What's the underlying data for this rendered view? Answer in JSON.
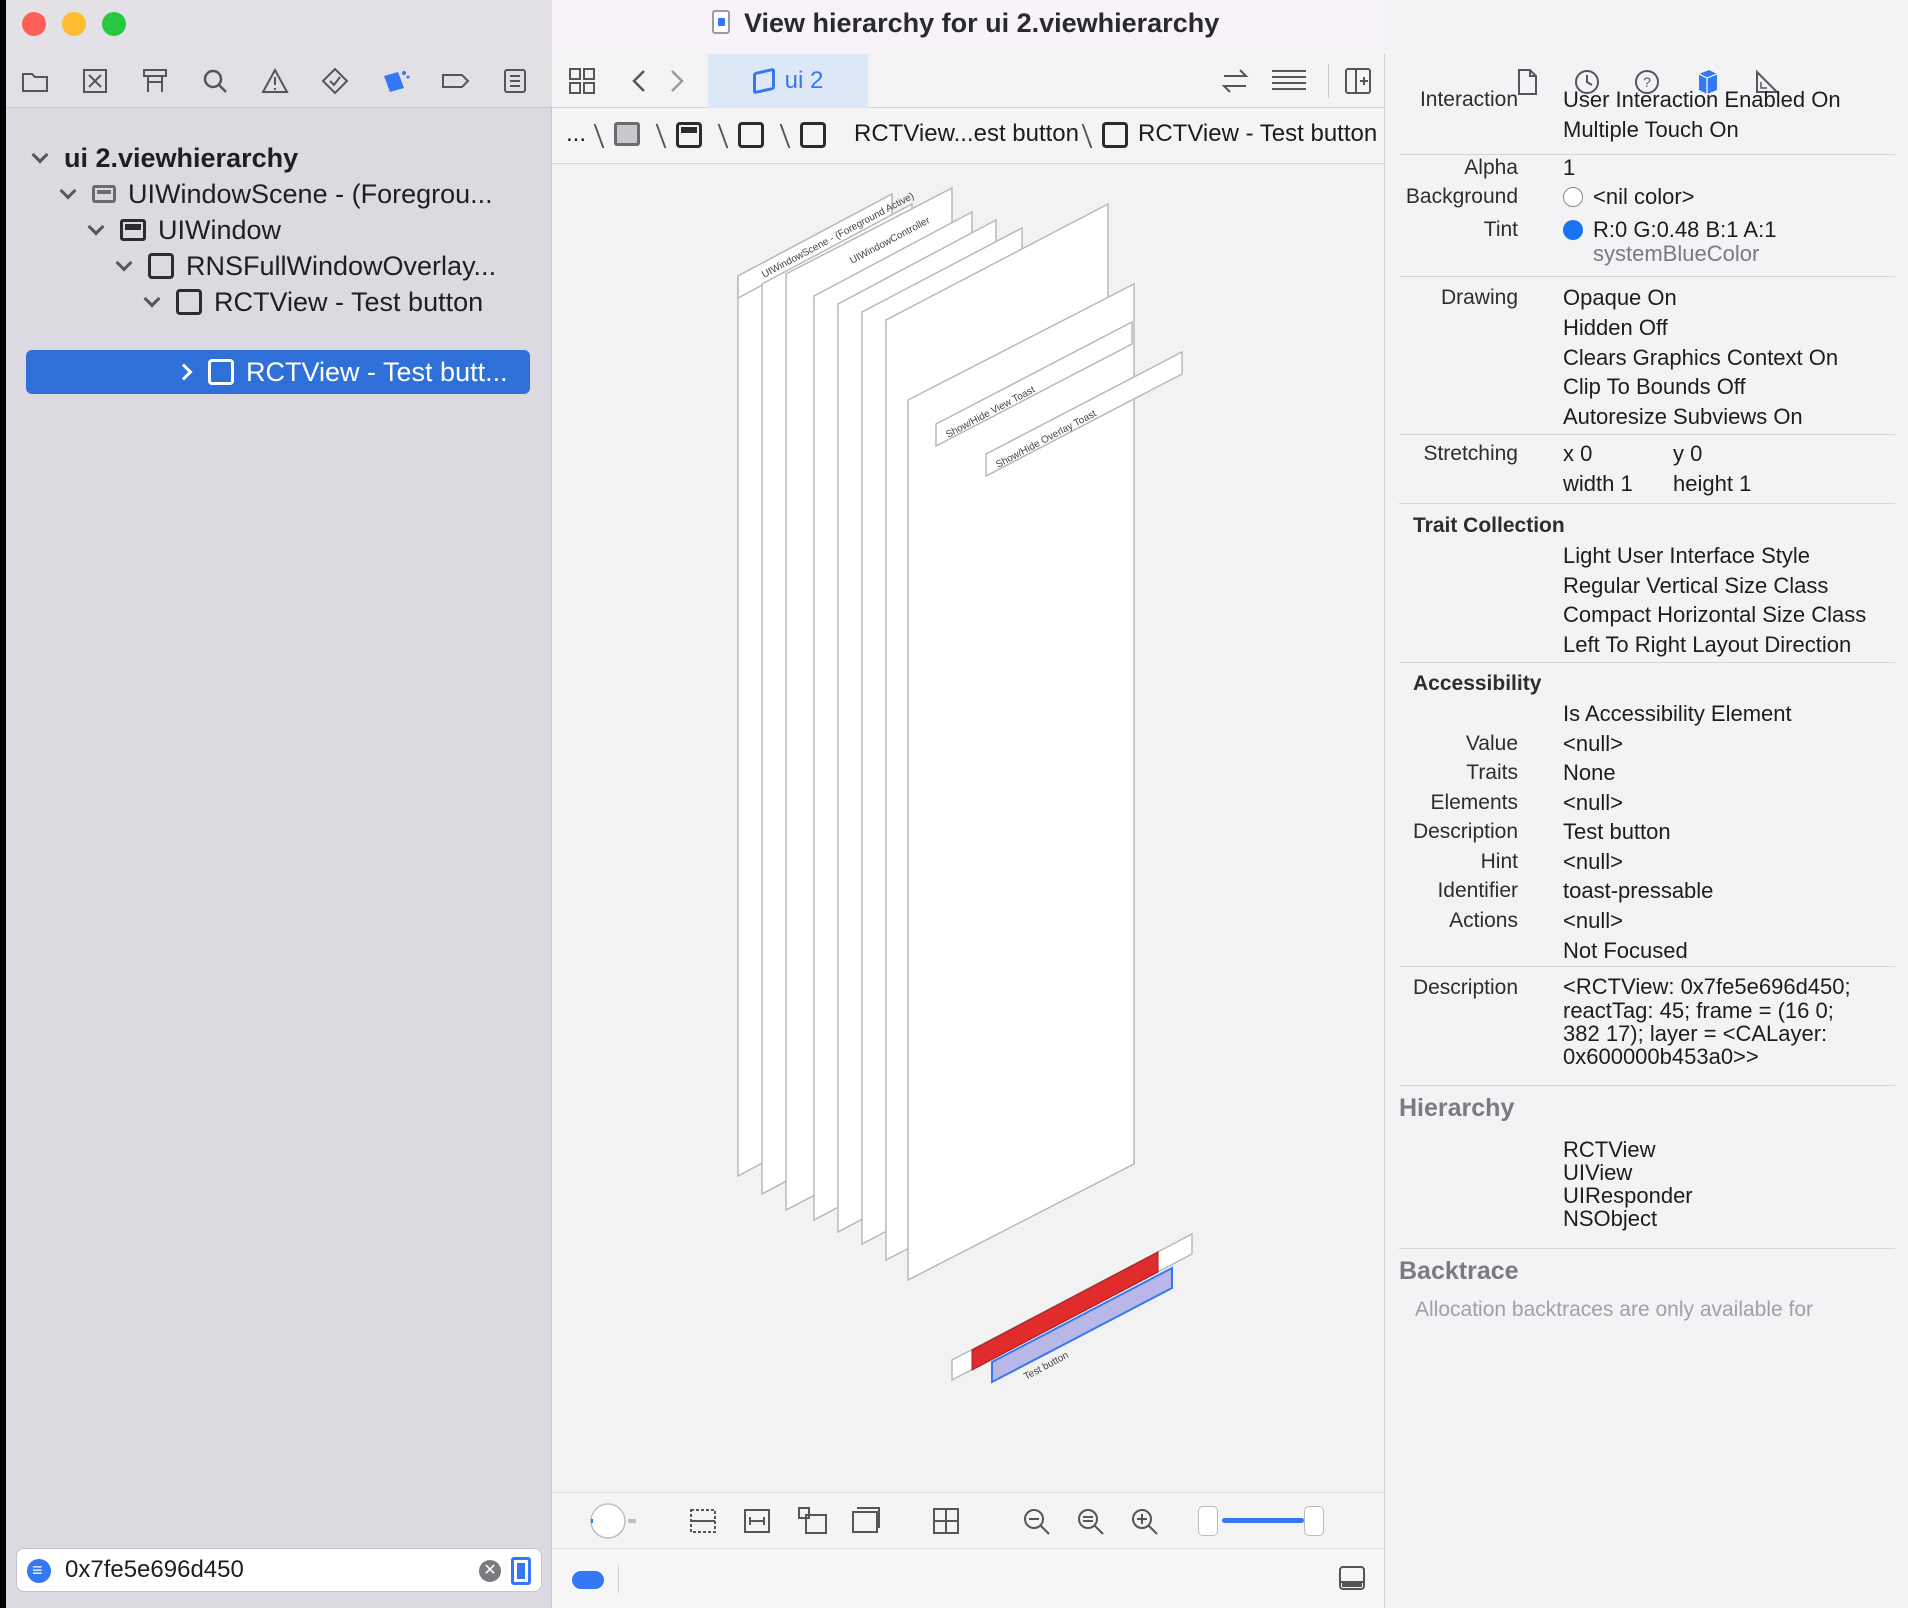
{
  "window": {
    "title": "View hierarchy for ui 2.viewhierarchy"
  },
  "colors": {
    "accent": "#3478f6",
    "selection": "#2f6fd8",
    "highlight_red": "#e02c2c",
    "traffic_red": "#fe5f57",
    "traffic_yellow": "#febc2e",
    "traffic_green": "#28c840"
  },
  "navigator": {
    "icons": [
      "folder-icon",
      "source-control-icon",
      "hierarchy-icon",
      "search-icon",
      "warning-icon",
      "test-icon",
      "debug-icon",
      "breakpoint-icon",
      "report-icon"
    ],
    "tree": [
      {
        "label": "ui 2.viewhierarchy",
        "level": 0
      },
      {
        "label": "UIWindowScene - (Foregrou...",
        "level": 1
      },
      {
        "label": "UIWindow",
        "level": 2
      },
      {
        "label": "RNSFullWindowOverlay...",
        "level": 3
      },
      {
        "label": "RCTView - Test button",
        "level": 4
      },
      {
        "label": "RCTView - Test butt...",
        "level": 5
      }
    ],
    "filter": {
      "value": "0x7fe5e696d450"
    }
  },
  "editor": {
    "tab": "ui 2",
    "breadcrumb": {
      "ellipsis": "...",
      "item_short": "RCTView...est button",
      "item_current": "RCTView - Test button"
    },
    "canvas": {
      "layer_labels": [
        "UIWindowScene - (Foreground Active)",
        "UIWindowController",
        "Show/Hide View Toast",
        "Show/Hide Overlay Toast",
        "Test button"
      ],
      "zoom_fraction": 0.85
    }
  },
  "inspector": {
    "interaction": {
      "label": "Interaction",
      "values": [
        "User Interaction Enabled On",
        "Multiple Touch On"
      ]
    },
    "alpha": {
      "label": "Alpha",
      "value": "1"
    },
    "background": {
      "label": "Background",
      "value": "<nil color>"
    },
    "tint": {
      "label": "Tint",
      "value": "R:0 G:0.48 B:1 A:1",
      "name": "systemBlueColor"
    },
    "drawing": {
      "label": "Drawing",
      "values": [
        "Opaque On",
        "Hidden Off",
        "Clears Graphics Context On",
        "Clip To Bounds Off",
        "Autoresize Subviews On"
      ]
    },
    "stretching": {
      "label": "Stretching",
      "x_label": "x",
      "x": "0",
      "y_label": "y",
      "y": "0",
      "width_label": "width",
      "width": "1",
      "height_label": "height",
      "height": "1"
    },
    "trait_collection": {
      "heading": "Trait Collection",
      "values": [
        "Light User Interface Style",
        "Regular Vertical Size Class",
        "Compact Horizontal Size Class",
        "Left To Right Layout Direction"
      ]
    },
    "accessibility": {
      "heading": "Accessibility",
      "element": "Is Accessibility Element",
      "rows": [
        {
          "label": "Value",
          "value": "<null>"
        },
        {
          "label": "Traits",
          "value": "None"
        },
        {
          "label": "Elements",
          "value": "<null>"
        },
        {
          "label": "Description",
          "value": "Test button"
        },
        {
          "label": "Hint",
          "value": "<null>"
        },
        {
          "label": "Identifier",
          "value": "toast-pressable"
        },
        {
          "label": "Actions",
          "value": "<null>"
        }
      ],
      "focus": "Not Focused"
    },
    "description": {
      "label": "Description",
      "lines": [
        "<RCTView: 0x7fe5e696d450;",
        "reactTag: 45; frame = (16 0;",
        "382 17); layer = <CALayer:",
        "0x600000b453a0>>"
      ]
    },
    "hierarchy": {
      "heading": "Hierarchy",
      "items": [
        "RCTView",
        "UIView",
        "UIResponder",
        "NSObject"
      ]
    },
    "backtrace": {
      "heading": "Backtrace",
      "note": "Allocation backtraces are only available for"
    }
  }
}
